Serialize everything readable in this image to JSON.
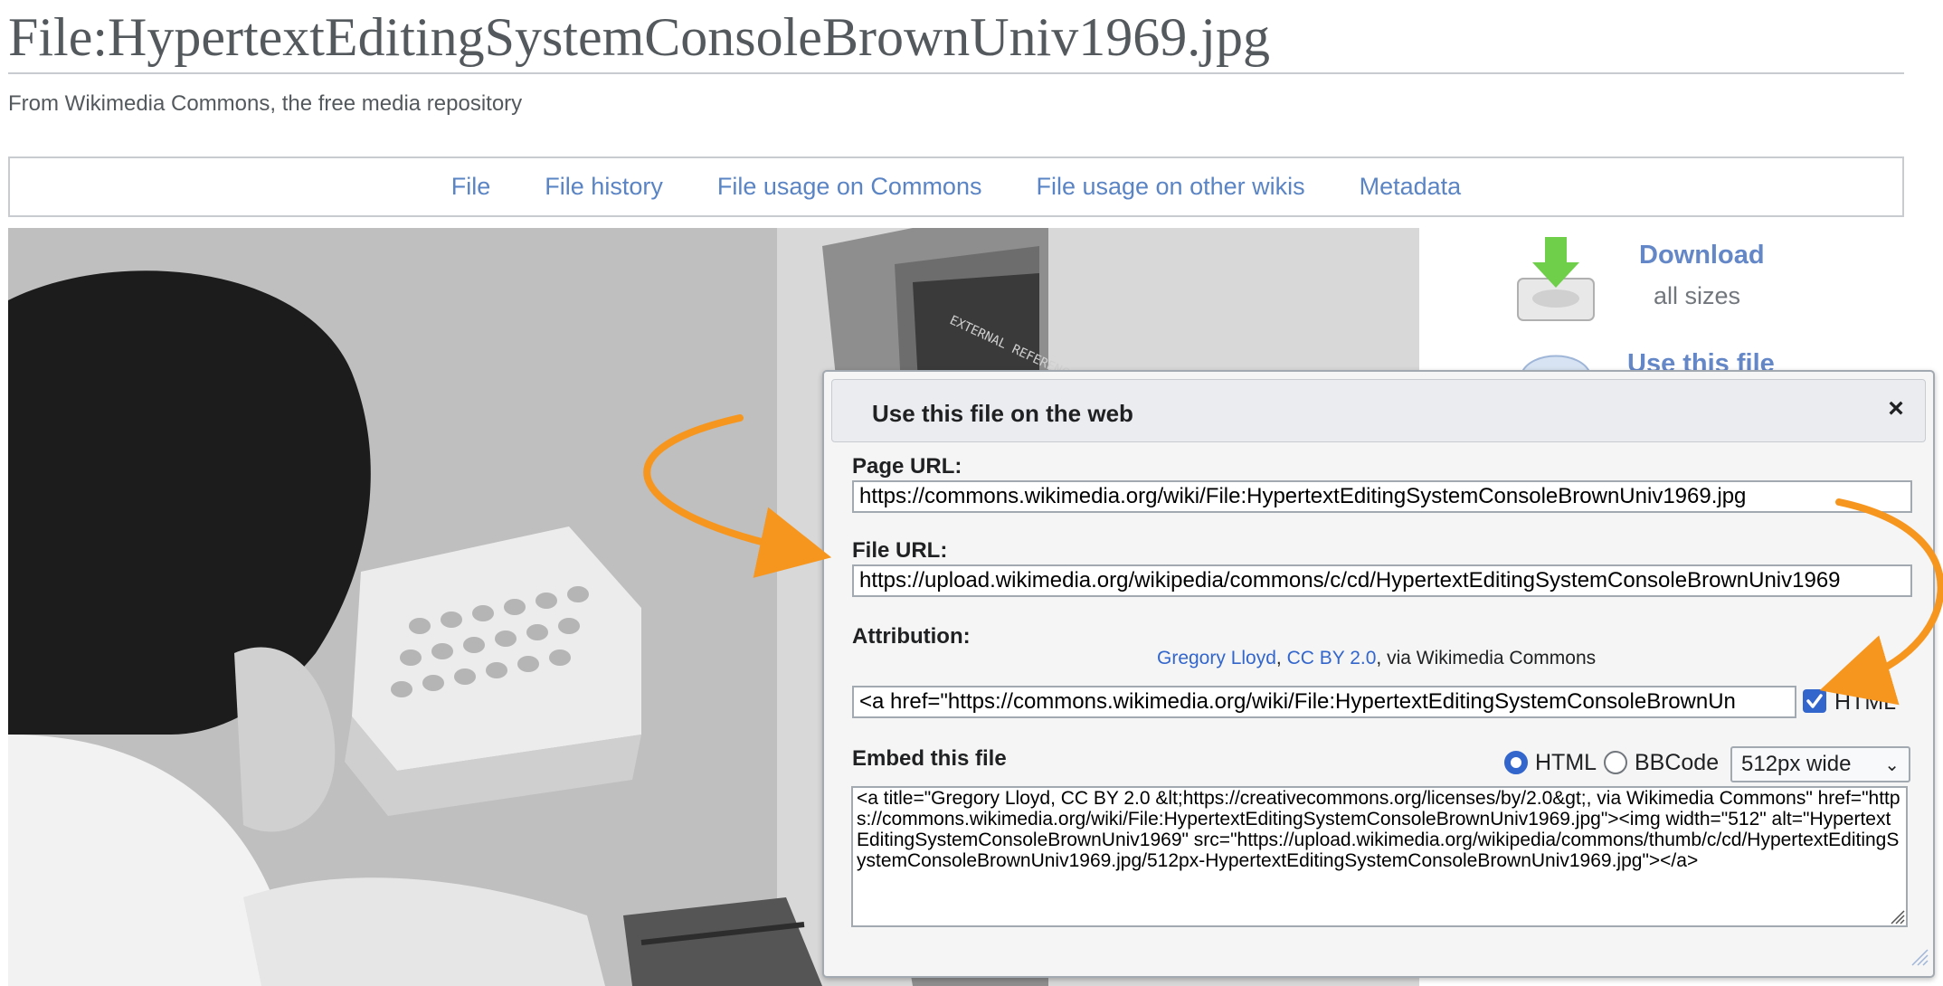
{
  "page": {
    "title": "File:HypertextEditingSystemConsoleBrownUniv1969.jpg",
    "tagline": "From Wikimedia Commons, the free media repository"
  },
  "filetoc": [
    "File",
    "File history",
    "File usage on Commons",
    "File usage on other wikis",
    "Metadata"
  ],
  "sidebar": {
    "download_label": "Download",
    "download_sub": "all sizes",
    "use_file_label": "Use this file"
  },
  "dialog": {
    "title": "Use this file on the web",
    "close": "×",
    "page_url_label": "Page URL:",
    "page_url_value": "https://commons.wikimedia.org/wiki/File:HypertextEditingSystemConsoleBrownUniv1969.jpg",
    "file_url_label": "File URL:",
    "file_url_value": "https://upload.wikimedia.org/wikipedia/commons/c/cd/HypertextEditingSystemConsoleBrownUniv1969",
    "attribution_label": "Attribution:",
    "attribution_author": "Gregory Lloyd",
    "attribution_sep": ", ",
    "attribution_license": "CC BY 2.0",
    "attribution_suffix": ", via Wikimedia Commons",
    "attribution_html_value": "<a href=\"https://commons.wikimedia.org/wiki/File:HypertextEditingSystemConsoleBrownUn",
    "html_checkbox_label": "HTML",
    "embed_label": "Embed this file",
    "format_html": "HTML",
    "format_bbcode": "BBCode",
    "size_select": "512px wide",
    "embed_code": "<a title=\"Gregory Lloyd, CC BY 2.0 &lt;https://creativecommons.org/licenses/by/2.0&gt;, via Wikimedia Commons\" href=\"https://commons.wikimedia.org/wiki/File:HypertextEditingSystemConsoleBrownUniv1969.jpg\"><img width=\"512\" alt=\"HypertextEditingSystemConsoleBrownUniv1969\" src=\"https://upload.wikimedia.org/wikipedia/commons/thumb/c/cd/HypertextEditingSystemConsoleBrownUniv1969.jpg/512px-HypertextEditingSystemConsoleBrownUniv1969.jpg\"></a>"
  },
  "colors": {
    "link": "#3366cc",
    "annotation_arrow": "#f7961e"
  }
}
